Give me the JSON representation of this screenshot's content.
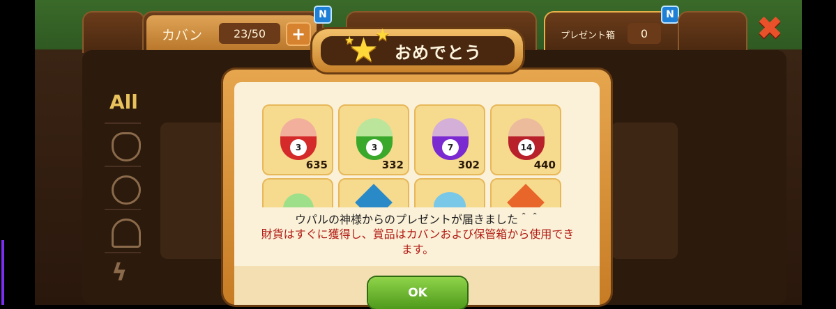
{
  "tabs": {
    "bag": {
      "label": "カバン",
      "count": "23/50",
      "plus": "+",
      "badge": "N"
    },
    "present": {
      "label": "プレゼント箱",
      "count": "0",
      "badge": "N"
    },
    "close": "✖"
  },
  "sidebar": {
    "all_label": "All",
    "icons": [
      "egg-icon",
      "orb-icon",
      "tree-icon",
      "bolt-icon"
    ]
  },
  "dialog": {
    "title": "おめでとう",
    "items": [
      {
        "icon": "red-capsule-icon",
        "ball": "3",
        "count": "635",
        "color": "#d42a2a"
      },
      {
        "icon": "green-capsule-icon",
        "ball": "3",
        "count": "332",
        "color": "#3aa82a"
      },
      {
        "icon": "purple-capsule-icon",
        "ball": "7",
        "count": "302",
        "color": "#7a2ad0"
      },
      {
        "icon": "red-capsule-icon",
        "ball": "14",
        "count": "440",
        "color": "#b8202a"
      }
    ],
    "partial_items": [
      "green-capsule-icon",
      "blue-badge-icon",
      "blue-gem-icon",
      "orange-badge-icon"
    ],
    "message_line1": "ウパルの神様からのプレゼントが届きました＾＾",
    "message_line2a": "財貨はすぐに獲得し、賞品はカバンおよび保管箱から使用でき",
    "message_line2b": "ます。",
    "ok_label": "OK"
  }
}
